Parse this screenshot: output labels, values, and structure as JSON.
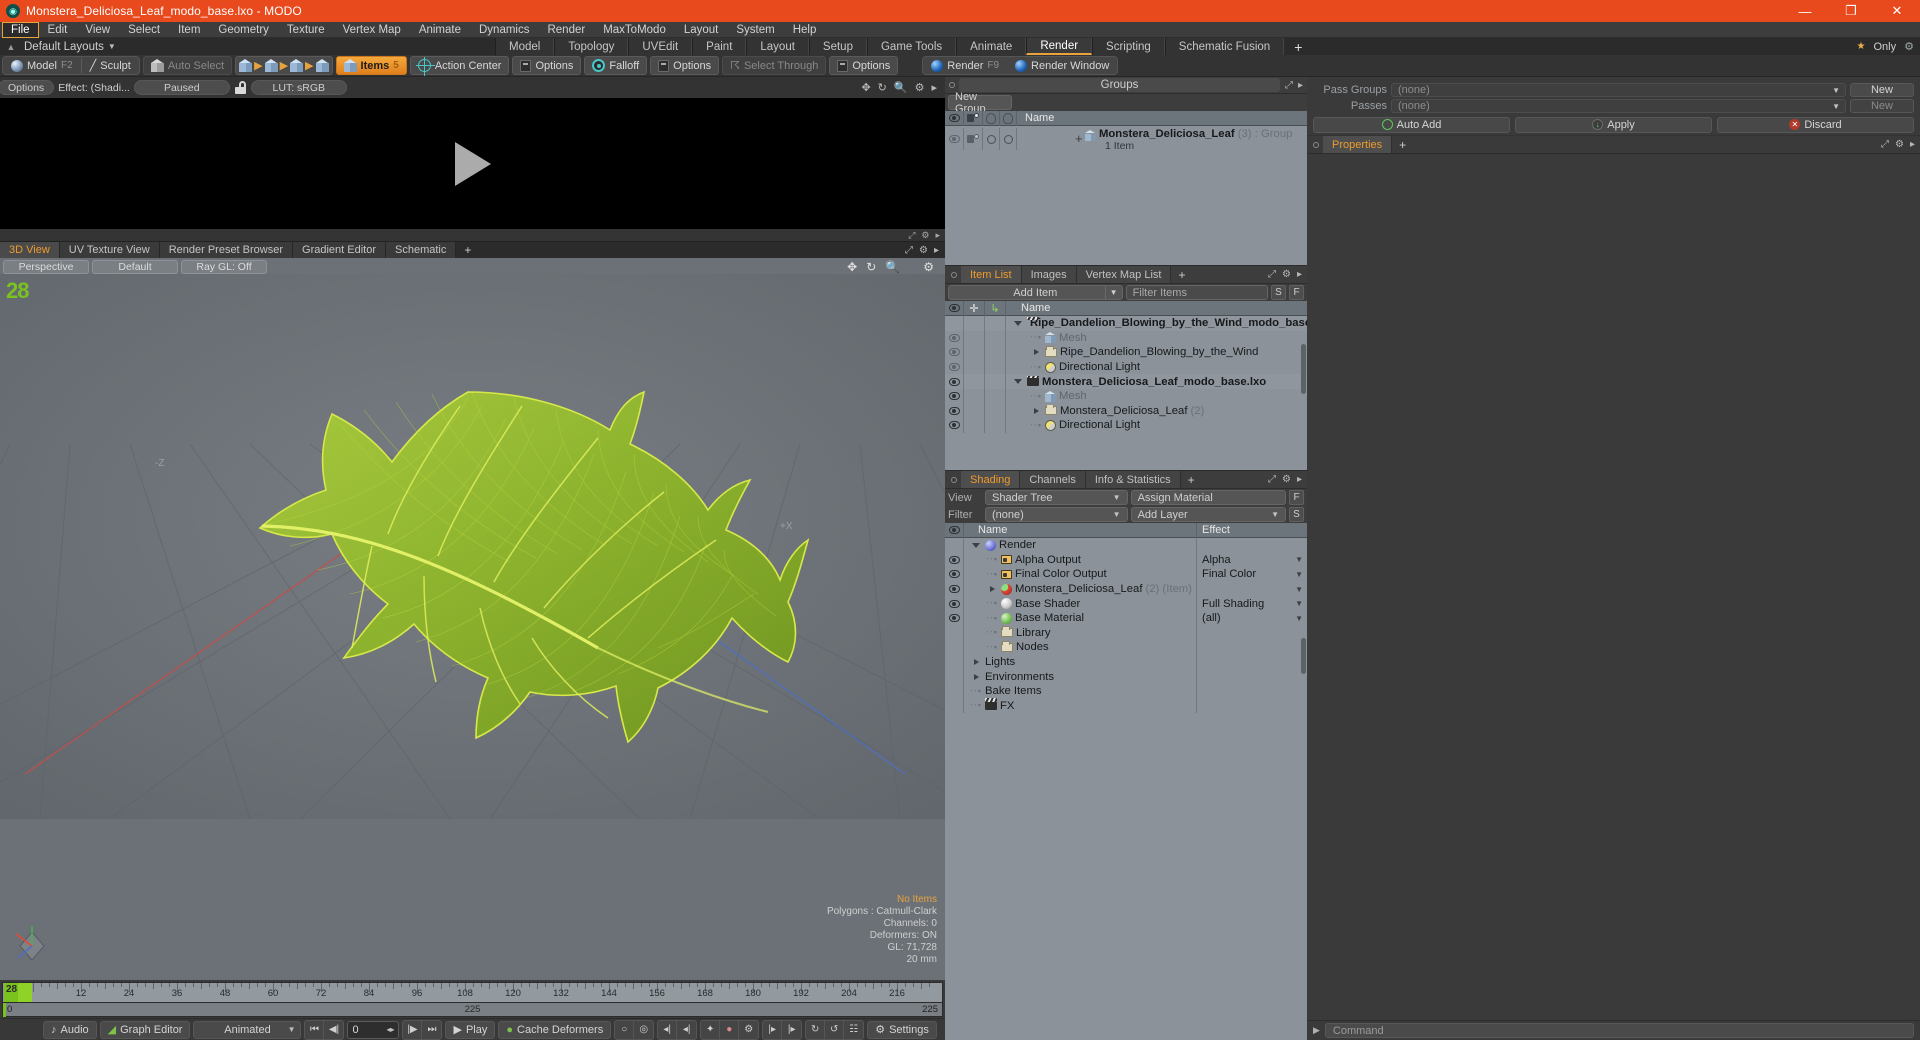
{
  "window": {
    "title": "Monstera_Deliciosa_Leaf_modo_base.lxo - MODO",
    "app_icon": "modo-icon",
    "minimize": "—",
    "maximize": "❐",
    "close": "✕"
  },
  "menubar": {
    "items": [
      "File",
      "Edit",
      "View",
      "Select",
      "Item",
      "Geometry",
      "Texture",
      "Vertex Map",
      "Animate",
      "Dynamics",
      "Render",
      "MaxToModo",
      "Layout",
      "System",
      "Help"
    ],
    "active": "File"
  },
  "layout_row": {
    "default_layouts": "Default Layouts",
    "tabs": [
      "Model",
      "Topology",
      "UVEdit",
      "Paint",
      "Layout",
      "Setup",
      "Game Tools",
      "Animate",
      "Render",
      "Scripting",
      "Schematic Fusion"
    ],
    "selected_tab": "Render",
    "add_tab": "+",
    "only_label": "Only"
  },
  "modebar": {
    "model": "Model",
    "model_key": "F2",
    "sculpt": "Sculpt",
    "auto_select": "Auto Select",
    "items": "Items",
    "items_key": "5",
    "action_center": "Action Center",
    "options1": "Options",
    "falloff": "Falloff",
    "options2": "Options",
    "select_through": "Select Through",
    "options3": "Options",
    "render": "Render",
    "render_key": "F9",
    "render_window": "Render Window"
  },
  "render_preview": {
    "options": "Options",
    "effect": "Effect: (Shadi...",
    "state": "Paused",
    "lut": "LUT: sRGB",
    "play_icon": "play-triangle"
  },
  "viewport_tabs": {
    "tabs": [
      "3D View",
      "UV Texture View",
      "Render Preset Browser",
      "Gradient Editor",
      "Schematic"
    ],
    "selected": "3D View",
    "add": "+"
  },
  "viewport": {
    "perspective": "Perspective",
    "shading_preset": "Default",
    "raygl": "Ray GL: Off",
    "frame_counter": "28",
    "axis_plus_x": "+X",
    "axis_minus_z": "-Z",
    "stats": {
      "no_items": "No Items",
      "polygons": "Polygons : Catmull-Clark",
      "channels": "Channels: 0",
      "deformers": "Deformers: ON",
      "gl": "GL: 71,728",
      "scale": "20 mm"
    }
  },
  "timeline": {
    "ticks": [
      12,
      24,
      36,
      48,
      60,
      72,
      84,
      96,
      108,
      120,
      132,
      144,
      156,
      168,
      180,
      192,
      204,
      216
    ],
    "current_frame": "28",
    "range_start": "0",
    "range_mid": "225",
    "range_end": "225"
  },
  "bottom_bar": {
    "audio": "Audio",
    "graph_editor": "Graph Editor",
    "animated": "Animated",
    "frame_value": "0",
    "play": "Play",
    "cache_deformers": "Cache Deformers",
    "settings": "Settings"
  },
  "groups_panel": {
    "title": "Groups",
    "new_group": "New Group",
    "columns": [
      "eye",
      "shade",
      "bulb-a",
      "bulb-b",
      "Name"
    ],
    "name_header": "Name",
    "rows": [
      {
        "name": "Monstera_Deliciosa_Leaf",
        "count": "(3)",
        "kind": ": Group",
        "sub": "1 Item"
      }
    ]
  },
  "item_list": {
    "tabs": [
      "Item List",
      "Images",
      "Vertex Map List"
    ],
    "selected_tab": "Item List",
    "add": "+",
    "add_item": "Add Item",
    "filter_placeholder": "Filter Items",
    "s_button": "S",
    "f_button": "F",
    "name_header": "Name",
    "rows": [
      {
        "name": "Ripe_Dandelion_Blowing_by_the_Wind_modo_base.lxo",
        "icon": "scene-icon",
        "indent": 0,
        "expanded": true,
        "bold": true,
        "eye": false
      },
      {
        "name": "Mesh",
        "icon": "mesh-icon",
        "indent": 1,
        "dim": true,
        "eye": true,
        "eye_dim": true
      },
      {
        "name": "Ripe_Dandelion_Blowing_by_the_Wind",
        "icon": "folder-icon",
        "indent": 1,
        "collapsed": true,
        "eye": true,
        "eye_dim": true
      },
      {
        "name": "Directional Light",
        "icon": "light-icon",
        "indent": 1,
        "eye": true,
        "eye_dim": true
      },
      {
        "name": "Monstera_Deliciosa_Leaf_modo_base.lxo",
        "icon": "scene-icon",
        "indent": 0,
        "expanded": true,
        "bold": true,
        "eye": true
      },
      {
        "name": "Mesh",
        "icon": "mesh-icon",
        "indent": 1,
        "dim": true,
        "eye": true
      },
      {
        "name": "Monstera_Deliciosa_Leaf",
        "count": "(2)",
        "icon": "folder-icon",
        "indent": 1,
        "collapsed": true,
        "eye": true
      },
      {
        "name": "Directional Light",
        "icon": "light-icon",
        "indent": 1,
        "eye": true
      }
    ]
  },
  "shading_panel": {
    "tabs": [
      "Shading",
      "Channels",
      "Info & Statistics"
    ],
    "selected_tab": "Shading",
    "add": "+",
    "view_label": "View",
    "view_value": "Shader Tree",
    "assign_material": "Assign Material",
    "f_button": "F",
    "filter_label": "Filter",
    "filter_value": "(none)",
    "add_layer": "Add Layer",
    "s_button": "S",
    "name_header": "Name",
    "effect_header": "Effect",
    "rows": [
      {
        "name": "Render",
        "effect": "",
        "icon": "render-sphere-icon",
        "indent": 0,
        "expanded": true,
        "eye": false
      },
      {
        "name": "Alpha Output",
        "effect": "Alpha",
        "icon": "output-icon",
        "indent": 1,
        "eye": true,
        "dropdown": true
      },
      {
        "name": "Final Color Output",
        "effect": "Final Color",
        "icon": "output-icon",
        "indent": 1,
        "eye": true,
        "dropdown": true
      },
      {
        "name": "Monstera_Deliciosa_Leaf",
        "count": "(2) (Item)",
        "effect": "",
        "icon": "material-group-icon",
        "indent": 1,
        "collapsed": true,
        "eye": true,
        "dropdown": true
      },
      {
        "name": "Base Shader",
        "effect": "Full Shading",
        "icon": "shader-icon",
        "indent": 1,
        "eye": true,
        "dropdown": true
      },
      {
        "name": "Base Material",
        "effect": "(all)",
        "icon": "material-icon",
        "indent": 1,
        "eye": true,
        "dropdown": true
      },
      {
        "name": "Library",
        "effect": "",
        "icon": "folder-icon",
        "indent": 1,
        "eye": false
      },
      {
        "name": "Nodes",
        "effect": "",
        "icon": "folder-icon",
        "indent": 1,
        "eye": false
      },
      {
        "name": "Lights",
        "effect": "",
        "icon": "none",
        "indent": 0,
        "collapsed": true,
        "eye": false
      },
      {
        "name": "Environments",
        "effect": "",
        "icon": "none",
        "indent": 0,
        "collapsed": true,
        "eye": false
      },
      {
        "name": "Bake Items",
        "effect": "",
        "icon": "none",
        "indent": 0,
        "eye": false
      },
      {
        "name": "FX",
        "effect": "",
        "icon": "scene-icon",
        "indent": 0,
        "eye": false
      }
    ]
  },
  "passes_panel": {
    "pass_groups_label": "Pass Groups",
    "pass_groups_value": "(none)",
    "pass_groups_new": "New",
    "passes_label": "Passes",
    "passes_value": "(none)",
    "passes_new": "New",
    "auto_add": "Auto Add",
    "apply": "Apply",
    "discard": "Discard"
  },
  "properties_panel": {
    "tabs": [
      "Properties"
    ],
    "selected_tab": "Properties",
    "add": "+"
  },
  "command_bar": {
    "placeholder": "Command",
    "prompt": "▶"
  },
  "colors": {
    "title_bar": "#e8491d",
    "accent": "#e8a33d",
    "tab_active_text": "#ef9b2d",
    "tree_bg": "#8b9299",
    "viewport_bg": "#6b7176",
    "leaf_green": "#8fb834",
    "green_marker": "#7ac21e"
  }
}
